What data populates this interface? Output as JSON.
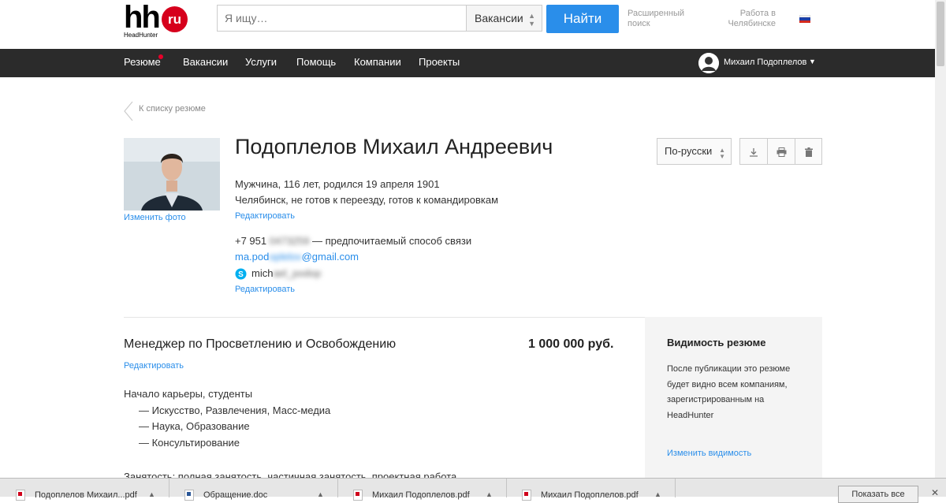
{
  "header": {
    "logo_text": "hh",
    "logo_badge": "ru",
    "logo_sub": "HeadHunter",
    "search_placeholder": "Я ищу…",
    "search_scope": "Вакансии",
    "find_label": "Найти",
    "advanced_search": "Расширенный поиск",
    "job_location": "Работа в Челябинске"
  },
  "nav": {
    "items": [
      "Резюме",
      "Вакансии",
      "Услуги",
      "Помощь",
      "Компании",
      "Проекты"
    ],
    "user_name": "Михаил Подоплелов"
  },
  "resume": {
    "back_link": "К списку резюме",
    "change_photo": "Изменить фото",
    "name": "Подоплелов Михаил Андреевич",
    "personal": "Мужчина, 116 лет, родился 19 апреля 1901",
    "location": "Челябинск, не готов к переезду, готов к командировкам",
    "edit": "Редактировать",
    "phone_prefix": "+7 951",
    "phone_hidden": "0473259",
    "phone_note": "— предпочитаемый способ связи",
    "email_prefix": "ma.pod",
    "email_hidden": "oplelov",
    "email_suffix": "@gmail.com",
    "skype_prefix": "mich",
    "skype_hidden": "ael_podop",
    "language": "По-русски",
    "position": "Менеджер по Просветлению и Освобождению",
    "salary": "1 000 000 руб.",
    "prof_area": "Начало карьеры, студенты",
    "specializations": [
      "— Искусство, Развлечения, Масс-медиа",
      "— Наука, Образование",
      "— Консультирование"
    ],
    "employment": "Занятость: полная занятость, частичная занятость, проектная работа"
  },
  "visibility": {
    "title": "Видимость резюме",
    "text": "После публикации это резюме будет видно всем компаниям, зарегистрированным на HeadHunter",
    "link": "Изменить видимость"
  },
  "downloads": {
    "items": [
      "Подоплелов Михаил...pdf",
      "Обращение.doc",
      "Михаил Подоплелов.pdf",
      "Михаил Подоплелов.pdf"
    ],
    "show_all": "Показать все"
  },
  "colors": {
    "accent": "#2a8eea",
    "brand": "#d6001c",
    "nav_bg": "#2b2b2b"
  }
}
